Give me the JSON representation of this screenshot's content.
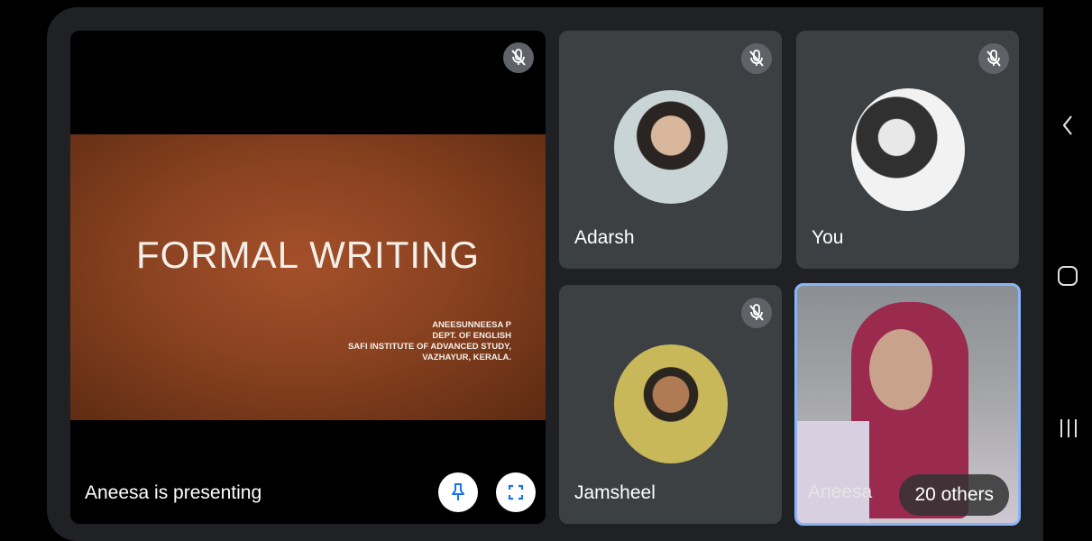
{
  "presentation": {
    "label": "Aneesa is presenting",
    "slide_title": "FORMAL WRITING",
    "slide_lines": [
      "ANEESUNNEESA P",
      "DEPT. OF ENGLISH",
      "SAFI INSTITUTE OF ADVANCED STUDY,",
      "VAZHAYUR, KERALA."
    ],
    "icons": [
      "mic-off-icon",
      "pin-icon",
      "fullscreen-icon"
    ]
  },
  "participants": [
    {
      "name": "Adarsh",
      "muted": true,
      "icon": "mic-off-icon"
    },
    {
      "name": "You",
      "muted": true,
      "icon": "mic-off-icon"
    },
    {
      "name": "Jamsheel",
      "muted": true,
      "icon": "mic-off-icon"
    },
    {
      "name": "Aneesa",
      "muted": false,
      "active_speaker": true
    }
  ],
  "others_count_label": "20 others",
  "nav": {
    "icons": [
      "back-chevron-icon",
      "home-icon",
      "recents-icon"
    ]
  },
  "colors": {
    "background": "#202124",
    "tile": "#3c4043",
    "mic_badge": "#5f6368",
    "active_border": "#8ab4f8",
    "slide": "#8a4220"
  }
}
